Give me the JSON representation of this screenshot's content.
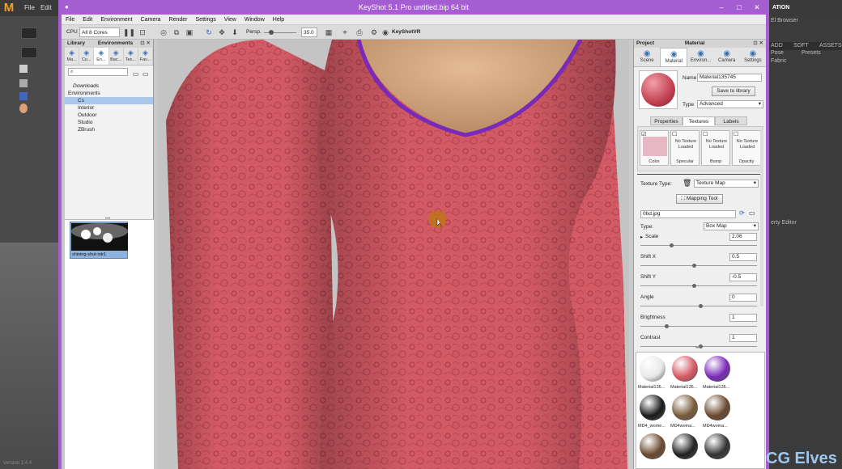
{
  "host": {
    "menu": [
      "File",
      "Edit"
    ],
    "right_panel": {
      "top_label": "ATION",
      "browser_label": "El Browser",
      "tabs": [
        "ADD",
        "SOFT",
        "ASSETS"
      ],
      "row2": [
        "Pose",
        "Presets"
      ],
      "text1": "Fabric",
      "editor_label": "erty Editor"
    },
    "bottom_left_text": "Version 1.4.4"
  },
  "window": {
    "title": "KeyShot 5.1 Pro    untitled.bip    64 bit",
    "menus": [
      "File",
      "Edit",
      "Environment",
      "Camera",
      "Render",
      "Settings",
      "View",
      "Window",
      "Help"
    ]
  },
  "toolbar": {
    "cpu_label": "CPU",
    "cpu_value": "All 8 Cores",
    "persp_label": "Persp.",
    "persp_value": "35.0",
    "keyshotvr_label": "KeyShotVR"
  },
  "library": {
    "header": "Library",
    "active_header": "Environments",
    "tabs": [
      {
        "label": "Ma...",
        "icon": "materials-icon"
      },
      {
        "label": "Co...",
        "icon": "colors-icon"
      },
      {
        "label": "En...",
        "icon": "environments-icon"
      },
      {
        "label": "Bac...",
        "icon": "backplates-icon"
      },
      {
        "label": "Tex...",
        "icon": "textures-icon"
      },
      {
        "label": "Fav...",
        "icon": "favorites-icon"
      }
    ],
    "search_placeholder": "",
    "tree": [
      {
        "label": "Downloads",
        "indent": 1,
        "italic": true
      },
      {
        "label": "Environments",
        "indent": 0,
        "expanded": true
      },
      {
        "label": "Cs",
        "indent": 2,
        "selected": true
      },
      {
        "label": "Interior",
        "indent": 2
      },
      {
        "label": "Outdoor",
        "indent": 2
      },
      {
        "label": "Studio",
        "indent": 2
      },
      {
        "label": "ZBrush",
        "indent": 2
      }
    ],
    "thumbnail_label": "shining-shut-intr1"
  },
  "material": {
    "header_left": "Project",
    "header_title": "Material",
    "tabs": [
      {
        "label": "Scene",
        "icon": "scene-icon"
      },
      {
        "label": "Material",
        "icon": "material-icon"
      },
      {
        "label": "Environ...",
        "icon": "environment-icon"
      },
      {
        "label": "Camera",
        "icon": "camera-icon"
      },
      {
        "label": "Settings",
        "icon": "settings-icon"
      }
    ],
    "name_label": "Name",
    "name_value": "Material135745",
    "save_button": "Save to library",
    "type_label": "Type",
    "type_value": "Advanced",
    "subtabs": [
      "Properties",
      "Textures",
      "Labels"
    ],
    "slots": [
      {
        "label": "Color",
        "text": ""
      },
      {
        "label": "Specular",
        "text": "No Texture Loaded"
      },
      {
        "label": "Bump",
        "text": "No Texture Loaded"
      },
      {
        "label": "Opacity",
        "text": "No Texture Loaded"
      }
    ],
    "texture_type_label": "Texture Type:",
    "texture_type_value": "Texture Map",
    "mapping_tool_button": "Mapping Tool",
    "file_value": "0bd.jpg",
    "type2_label": "Type:",
    "type2_value": "Box Map",
    "params": [
      {
        "label": "Scale",
        "value": "2.06"
      },
      {
        "label": "Shift X",
        "value": "0.5"
      },
      {
        "label": "Shift Y",
        "value": "-0.5"
      },
      {
        "label": "Angle",
        "value": "0"
      },
      {
        "label": "Brightness",
        "value": "1"
      },
      {
        "label": "Contrast",
        "value": "1"
      }
    ],
    "grid": [
      {
        "label": "Material135...",
        "color": "#e8e8e8"
      },
      {
        "label": "Material135...",
        "color": "#d45a63"
      },
      {
        "label": "Material135...",
        "color": "#7a2ab8"
      },
      {
        "label": "MD4_wome...",
        "color": "#1a1a1a"
      },
      {
        "label": "MD4woma...",
        "color": "#7a5a3a"
      },
      {
        "label": "MD4woma...",
        "color": "#6a4a30"
      },
      {
        "label": "",
        "color": "#6a4a30"
      },
      {
        "label": "",
        "color": "#222222"
      },
      {
        "label": "",
        "color": "#333333"
      }
    ]
  },
  "watermark": "CG Elves"
}
